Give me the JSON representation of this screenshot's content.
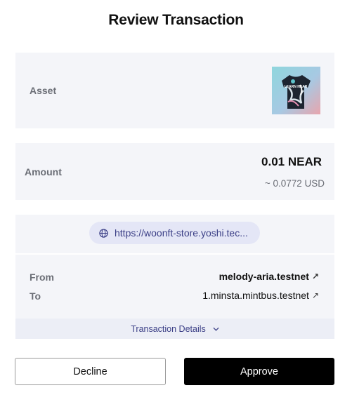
{
  "page": {
    "title": "Review Transaction"
  },
  "asset": {
    "label": "Asset",
    "image_icon": "tshirt-nft-thumbnail",
    "image_text": "LEARN NEAR"
  },
  "amount": {
    "label": "Amount",
    "value": "0.01 NEAR",
    "usd": "~ 0.0772 USD"
  },
  "origin": {
    "url": "https://woonft-store.yoshi.tec...",
    "icon": "globe-icon"
  },
  "parties": {
    "from_label": "From",
    "from_value": "melody-aria.testnet",
    "to_label": "To",
    "to_value": "1.minsta.mintbus.testnet",
    "link_icon": "↗"
  },
  "details": {
    "label": "Transaction Details",
    "icon": "chevron-down-icon"
  },
  "actions": {
    "decline_label": "Decline",
    "approve_label": "Approve"
  },
  "colors": {
    "accent": "#3b3f86",
    "card_bg": "#f4f5f9",
    "pill_bg": "#e4e6f6",
    "primary_button": "#000000"
  }
}
